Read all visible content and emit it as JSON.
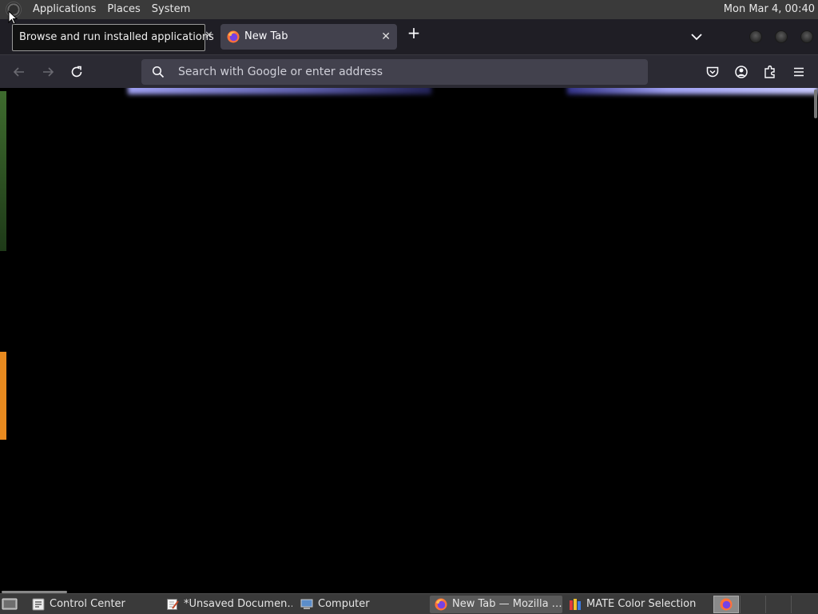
{
  "top_panel": {
    "menus": [
      "Applications",
      "Places",
      "System"
    ],
    "clock": "Mon Mar  4, 00:40"
  },
  "tooltip": "Browse and run installed applications",
  "browser": {
    "active_tab_title": "New Tab",
    "close_glyph": "✕",
    "new_tab_glyph": "+",
    "search_placeholder": "Search with Google or enter address"
  },
  "taskbar": {
    "items": [
      {
        "label": "Control Center",
        "icon": "control-center-icon"
      },
      {
        "label": "*Unsaved Documen…",
        "icon": "text-editor-icon"
      },
      {
        "label": "Computer",
        "icon": "computer-icon"
      },
      {
        "label": "New Tab — Mozilla …",
        "icon": "firefox-icon"
      },
      {
        "label": "MATE Color Selection",
        "icon": "color-selection-icon"
      }
    ]
  },
  "colors": {
    "panel": "#3a3a3a",
    "tabbar": "#1f1e25",
    "navbar": "#2b2a33",
    "urlbar": "#42414d",
    "content": "#000000"
  }
}
